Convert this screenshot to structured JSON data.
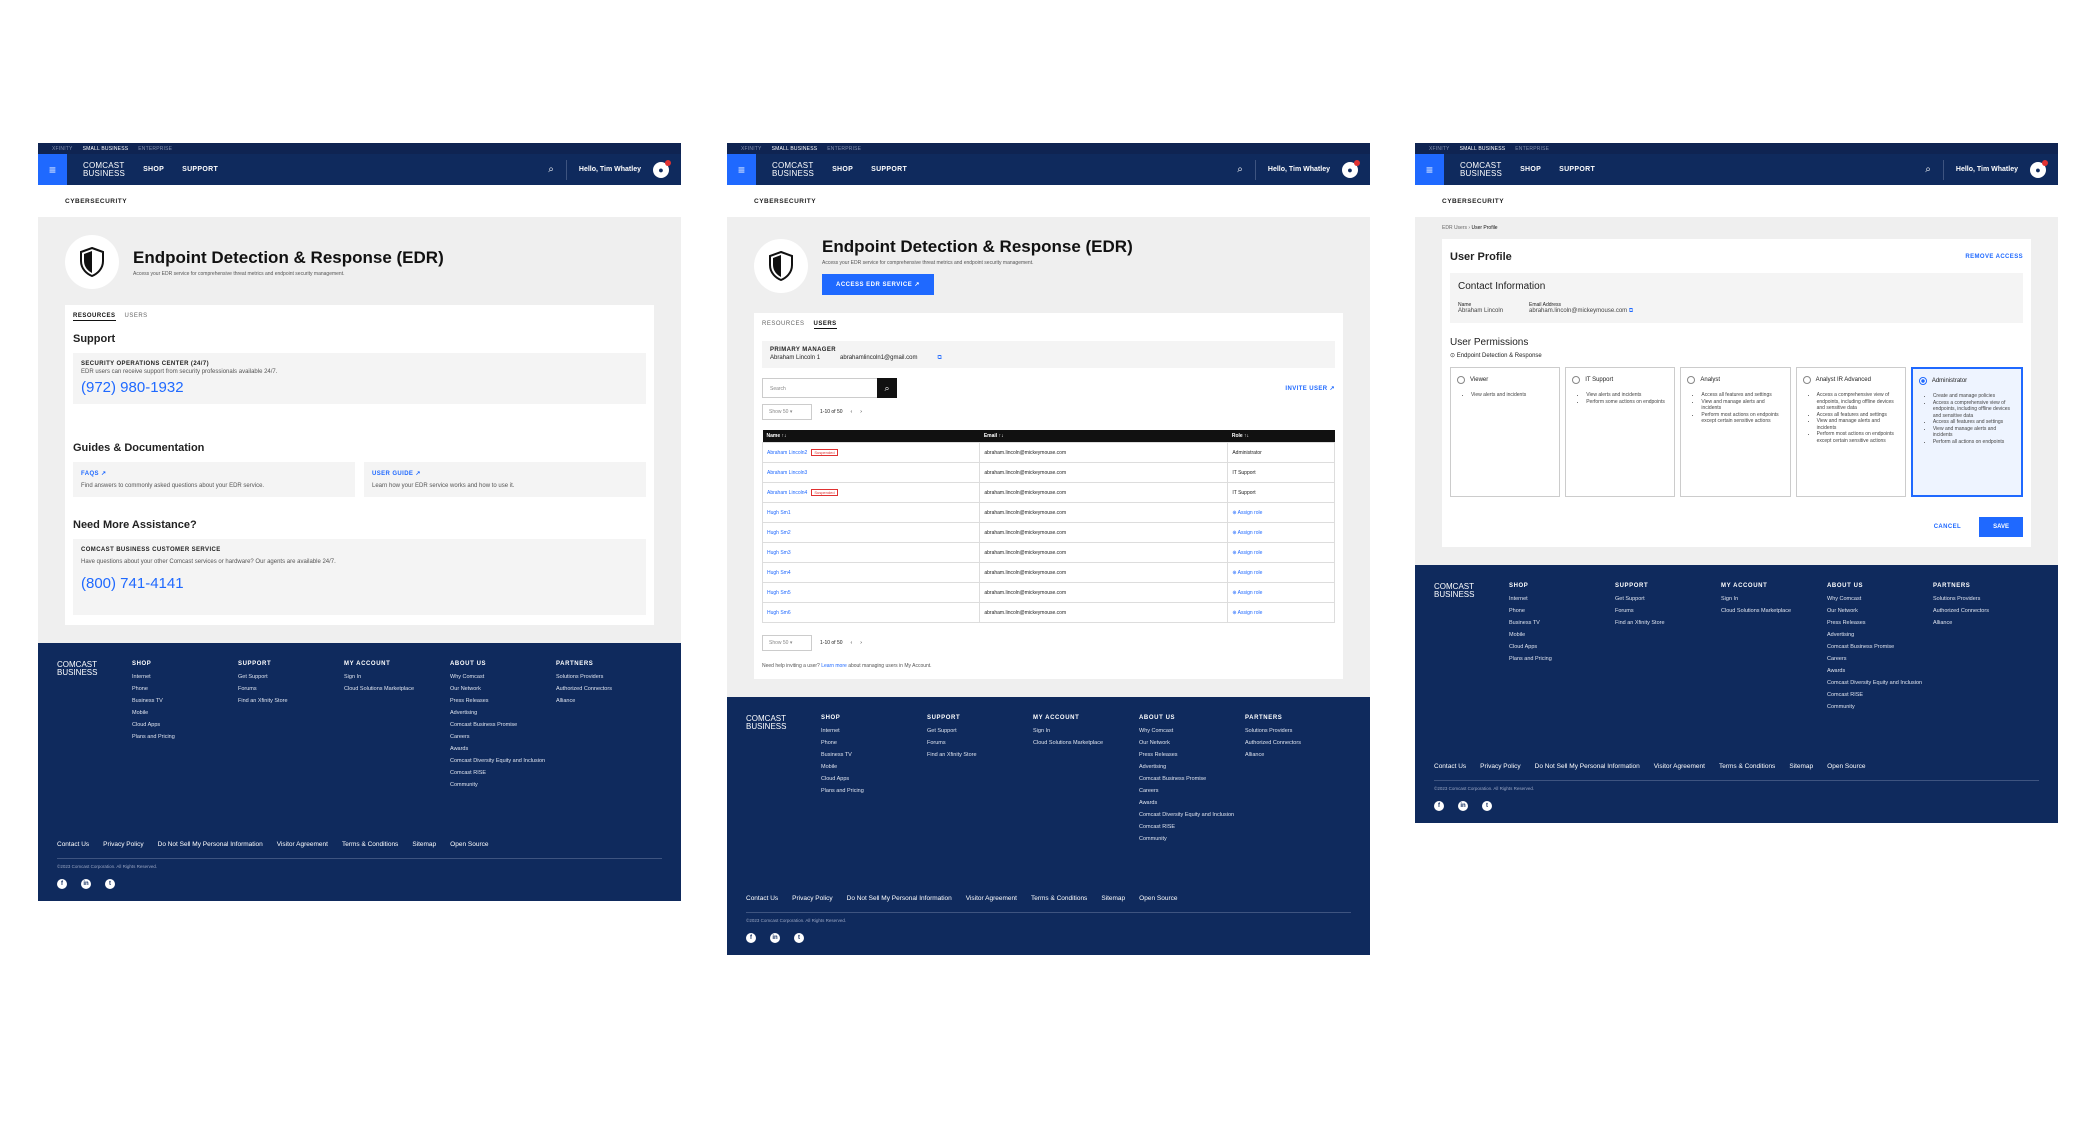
{
  "topbar": {
    "items": [
      "XFINITY",
      "SMALL BUSINESS",
      "ENTERPRISE"
    ]
  },
  "nav": {
    "logo_line1": "COMCAST",
    "logo_line2": "BUSINESS",
    "shop": "SHOP",
    "support": "SUPPORT",
    "greeting": "Hello, Tim Whatley",
    "menu_icon": "hamburger-icon",
    "search_icon": "search-icon"
  },
  "subnav": "CYBERSECURITY",
  "hero": {
    "title": "Endpoint Detection & Response (EDR)",
    "subtitle": "Access your EDR service for comprehensive threat metrics and endpoint security management.",
    "button": "ACCESS EDR SERVICE ↗"
  },
  "tabs": {
    "resources": "RESOURCES",
    "users": "USERS"
  },
  "resources": {
    "support_title": "Support",
    "soc_title": "SECURITY OPERATIONS CENTER (24/7)",
    "soc_desc": "EDR users can receive support from security professionals available 24/7.",
    "soc_phone": "(972) 980-1932",
    "guides_title": "Guides & Documentation",
    "faqs": "FAQS ↗",
    "faqs_desc": "Find answers to commonly asked questions about your EDR service.",
    "guide": "USER GUIDE ↗",
    "guide_desc": "Learn how your EDR service works and how to use it.",
    "assist_title": "Need More Assistance?",
    "cs_title": "COMCAST BUSINESS CUSTOMER SERVICE",
    "cs_desc": "Have questions about your other Comcast services or hardware? Our agents are available 24/7.",
    "cs_phone": "(800) 741-4141"
  },
  "users": {
    "pm_label": "PRIMARY MANAGER",
    "pm_name": "Abraham Lincoln 1",
    "pm_email": "abrahamlincoln1@gmail.com",
    "search_placeholder": "Search",
    "invite": "INVITE USER ↗",
    "show": "Show 50",
    "range": "1-10 of 50",
    "headers": [
      "Name ↑↓",
      "Email ↑↓",
      "Role ↑↓"
    ],
    "rows": [
      {
        "name": "Abraham Lincoln2",
        "badge": "Suspended",
        "email": "abraham.lincoln@mickeymouse.com",
        "role": "Administrator"
      },
      {
        "name": "Abraham Lincoln3",
        "badge": "",
        "email": "abraham.lincoln@mickeymouse.com",
        "role": "IT Support"
      },
      {
        "name": "Abraham Lincoln4",
        "badge": "Suspended",
        "email": "abraham.lincoln@mickeymouse.com",
        "role": "IT Support"
      },
      {
        "name": "Hugh Sm1",
        "badge": "",
        "email": "abraham.lincoln@mickeymouse.com",
        "role": "⊕ Assign role"
      },
      {
        "name": "Hugh Sm2",
        "badge": "",
        "email": "abraham.lincoln@mickeymouse.com",
        "role": "⊕ Assign role"
      },
      {
        "name": "Hugh Sm3",
        "badge": "",
        "email": "abraham.lincoln@mickeymouse.com",
        "role": "⊕ Assign role"
      },
      {
        "name": "Hugh Sm4",
        "badge": "",
        "email": "abraham.lincoln@mickeymouse.com",
        "role": "⊕ Assign role"
      },
      {
        "name": "Hugh Sm5",
        "badge": "",
        "email": "abraham.lincoln@mickeymouse.com",
        "role": "⊕ Assign role"
      },
      {
        "name": "Hugh Sm6",
        "badge": "",
        "email": "abraham.lincoln@mickeymouse.com",
        "role": "⊕ Assign role"
      }
    ],
    "help_pre": "Need help inviting a user?",
    "help_link": "Learn more",
    "help_post": "about managing users in My Account."
  },
  "profile": {
    "crumb1": "EDR Users",
    "crumb2": "User Profile",
    "title": "User Profile",
    "remove": "REMOVE ACCESS",
    "contact_title": "Contact Information",
    "name_label": "Name",
    "name": "Abraham Lincoln",
    "email_label": "Email Address",
    "email": "abraham.lincoln@mickeymouse.com",
    "perm_title": "User Permissions",
    "perm_product": "Endpoint Detection & Response",
    "roles": [
      {
        "name": "Viewer",
        "items": [
          "View alerts and incidents"
        ]
      },
      {
        "name": "IT Support",
        "items": [
          "View alerts and incidents",
          "Perform some actions on endpoints"
        ]
      },
      {
        "name": "Analyst",
        "items": [
          "Access all features and settings",
          "View and manage alerts and incidents",
          "Perform most actions on endpoints except certain sensitive actions"
        ]
      },
      {
        "name": "Analyst IR Advanced",
        "items": [
          "Access a comprehensive view of endpoints, including offline devices and sensitive data",
          "Access all features and settings",
          "View and manage alerts and incidents",
          "Perform most actions on endpoints except certain sensitive actions"
        ]
      },
      {
        "name": "Administrator",
        "items": [
          "Create and manage policies",
          "Access a comprehensive view of endpoints, including offline devices and sensitive data",
          "Access all features and settings",
          "View and manage alerts and incidents",
          "Perform all actions on endpoints"
        ]
      }
    ],
    "selected_role": "Administrator",
    "cancel": "CANCEL",
    "save": "SAVE"
  },
  "footer": {
    "cols": [
      {
        "h": "SHOP",
        "items": [
          "Internet",
          "Phone",
          "Business TV",
          "Mobile",
          "Cloud Apps",
          "Plans and Pricing"
        ]
      },
      {
        "h": "SUPPORT",
        "items": [
          "Get Support",
          "Forums",
          "Find an Xfinity Store"
        ]
      },
      {
        "h": "MY ACCOUNT",
        "items": [
          "Sign In",
          "Cloud Solutions Marketplace"
        ]
      },
      {
        "h": "ABOUT US",
        "items": [
          "Why Comcast",
          "Our Network",
          "Press Releases",
          "Advertising",
          "Comcast Business Promise",
          "Careers",
          "Awards",
          "Comcast Diversity Equity and Inclusion",
          "Comcast RISE",
          "Community"
        ]
      },
      {
        "h": "PARTNERS",
        "items": [
          "Solutions Providers",
          "Authorized Connectors",
          "Alliance"
        ]
      }
    ],
    "links": [
      "Contact Us",
      "Privacy Policy",
      "Do Not Sell My Personal Information",
      "Visitor Agreement",
      "Terms & Conditions",
      "Sitemap",
      "Open Source"
    ],
    "copyright": "©2023 Comcast Corporation. All Rights Reserved.",
    "social": [
      "facebook-icon",
      "linkedin-icon",
      "twitter-icon"
    ]
  },
  "colors": {
    "navy": "#0f2a5d",
    "accent": "#1f69ff",
    "alert": "#e03131"
  }
}
